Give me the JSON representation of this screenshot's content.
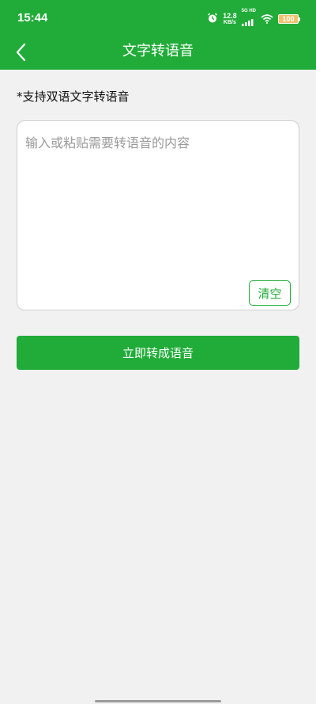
{
  "status_bar": {
    "time": "15:44",
    "net_speed_value": "12.8",
    "net_speed_unit": "KB/s",
    "signal_label": "5G HD",
    "battery": "100",
    "icons": [
      "alarm-icon",
      "signal-icon",
      "wifi-icon",
      "battery-icon"
    ]
  },
  "nav": {
    "title": "文字转语音",
    "back_icon": "chevron-left-icon"
  },
  "hint": "*支持双语文字转语音",
  "input": {
    "placeholder": "输入或粘贴需要转语音的内容",
    "value": "",
    "clear_label": "清空"
  },
  "convert_button": "立即转成语音",
  "colors": {
    "primary": "#21ac39",
    "background": "#f1f1f1",
    "card": "#ffffff",
    "placeholder": "#9a9a9a"
  }
}
